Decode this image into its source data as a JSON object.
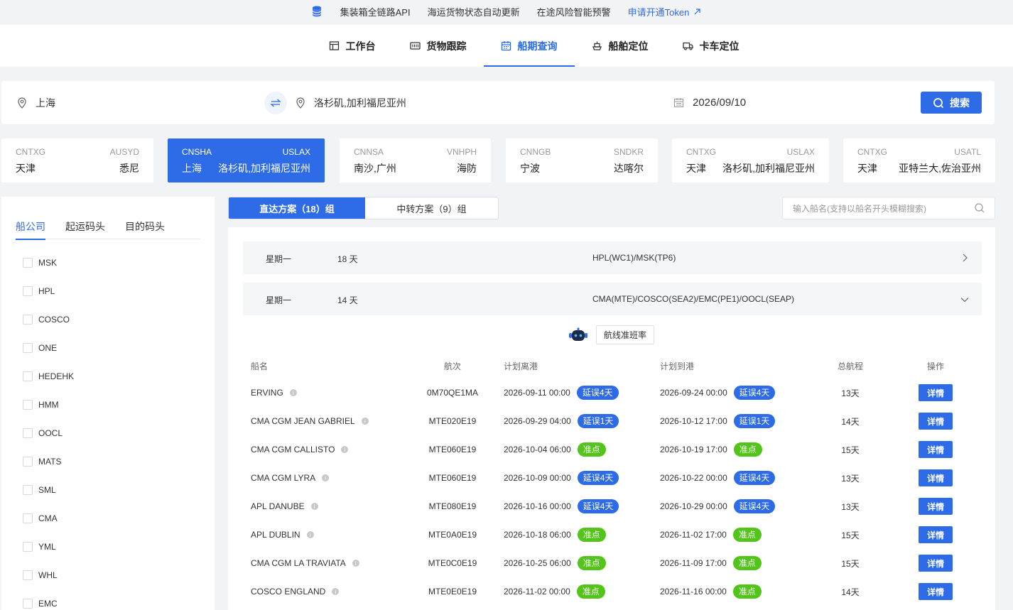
{
  "topbar": {
    "items": [
      "集装箱全链路API",
      "海运货物状态自动更新",
      "在途风险智能预警"
    ],
    "token_link": "申请开通Token"
  },
  "nav": {
    "items": [
      {
        "label": "工作台",
        "icon": "dashboard-icon"
      },
      {
        "label": "货物跟踪",
        "icon": "tracking-icon"
      },
      {
        "label": "船期查询",
        "icon": "calendar-icon"
      },
      {
        "label": "船舶定位",
        "icon": "ship-icon"
      },
      {
        "label": "卡车定位",
        "icon": "truck-icon"
      }
    ],
    "active_index": 2
  },
  "search": {
    "origin": "上海",
    "destination": "洛杉矶,加利福尼亚州",
    "date": "2026/09/10",
    "button_label": "搜索"
  },
  "routes": [
    {
      "from_code": "CNTXG",
      "to_code": "AUSYD",
      "from_name": "天津",
      "to_name": "悉尼"
    },
    {
      "from_code": "CNSHA",
      "to_code": "USLAX",
      "from_name": "上海",
      "to_name": "洛杉矶,加利福尼亚州"
    },
    {
      "from_code": "CNNSA",
      "to_code": "VNHPH",
      "from_name": "南沙,广州",
      "to_name": "海防"
    },
    {
      "from_code": "CNNGB",
      "to_code": "SNDKR",
      "from_name": "宁波",
      "to_name": "达喀尔"
    },
    {
      "from_code": "CNTXG",
      "to_code": "USLAX",
      "from_name": "天津",
      "to_name": "洛杉矶,加利福尼亚州"
    },
    {
      "from_code": "CNTXG",
      "to_code": "USATL",
      "from_name": "天津",
      "to_name": "亚特兰大,佐治亚州"
    }
  ],
  "filter": {
    "tabs": [
      "船公司",
      "起运码头",
      "目的码头"
    ],
    "carriers": [
      "MSK",
      "HPL",
      "COSCO",
      "ONE",
      "HEDEHK",
      "HMM",
      "OOCL",
      "MATS",
      "SML",
      "CMA",
      "YML",
      "WHL",
      "EMC"
    ]
  },
  "plan_tabs": {
    "direct": "直达方案（18）组",
    "transfer": "中转方案（9）组"
  },
  "vessel_search": {
    "placeholder": "输入船名(支持以船名开头模糊搜索)"
  },
  "groups": [
    {
      "weekday": "星期一",
      "days": "18 天",
      "services": "HPL(WC1)/MSK(TP6)"
    },
    {
      "weekday": "星期一",
      "days": "14 天",
      "services": "CMA(MTE)/COSCO(SEA2)/EMC(PE1)/OOCL(SEAP)"
    }
  ],
  "rate_button": "航线准班率",
  "table": {
    "headers": [
      "船名",
      "航次",
      "计划离港",
      "计划到港",
      "总航程",
      "操作"
    ],
    "detail_label": "详情",
    "rows": [
      {
        "vessel": "ERVING",
        "voyage": "0M70QE1MA",
        "etd": "2026-09-11 00:00",
        "etd_status": "延误4天",
        "etd_type": "delay",
        "eta": "2026-09-24 00:00",
        "eta_status": "延误4天",
        "eta_type": "delay",
        "transit": "13天"
      },
      {
        "vessel": "CMA CGM JEAN GABRIEL",
        "voyage": "MTE020E19",
        "etd": "2026-09-29 04:00",
        "etd_status": "延误1天",
        "etd_type": "delay",
        "eta": "2026-10-12 17:00",
        "eta_status": "延误1天",
        "eta_type": "delay",
        "transit": "14天"
      },
      {
        "vessel": "CMA CGM CALLISTO",
        "voyage": "MTE060E19",
        "etd": "2026-10-04 06:00",
        "etd_status": "准点",
        "etd_type": "ontime",
        "eta": "2026-10-19 17:00",
        "eta_status": "准点",
        "eta_type": "ontime",
        "transit": "15天"
      },
      {
        "vessel": "CMA CGM LYRA",
        "voyage": "MTE060E19",
        "etd": "2026-10-09 00:00",
        "etd_status": "延误4天",
        "etd_type": "delay",
        "eta": "2026-10-22 00:00",
        "eta_status": "延误4天",
        "eta_type": "delay",
        "transit": "13天"
      },
      {
        "vessel": "APL DANUBE",
        "voyage": "MTE080E19",
        "etd": "2026-10-16 00:00",
        "etd_status": "延误4天",
        "etd_type": "delay",
        "eta": "2026-10-29 00:00",
        "eta_status": "延误4天",
        "eta_type": "delay",
        "transit": "13天"
      },
      {
        "vessel": "APL DUBLIN",
        "voyage": "MTE0A0E19",
        "etd": "2026-10-18 06:00",
        "etd_status": "准点",
        "etd_type": "ontime",
        "eta": "2026-11-02 17:00",
        "eta_status": "准点",
        "eta_type": "ontime",
        "transit": "15天"
      },
      {
        "vessel": "CMA CGM LA TRAVIATA",
        "voyage": "MTE0C0E19",
        "etd": "2026-10-25 06:00",
        "etd_status": "准点",
        "etd_type": "ontime",
        "eta": "2026-11-09 17:00",
        "eta_status": "准点",
        "eta_type": "ontime",
        "transit": "15天"
      },
      {
        "vessel": "COSCO ENGLAND",
        "voyage": "MTE0E0E19",
        "etd": "2026-11-02 00:00",
        "etd_status": "准点",
        "etd_type": "ontime",
        "eta": "2026-11-16 00:00",
        "eta_status": "准点",
        "eta_type": "ontime",
        "transit": "14天"
      }
    ]
  }
}
